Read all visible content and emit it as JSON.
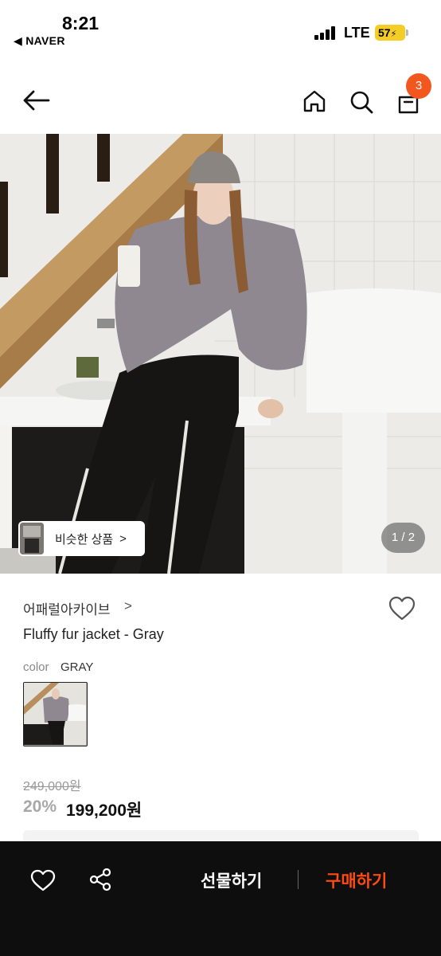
{
  "status_bar": {
    "time": "8:21",
    "back_app": "◀ NAVER",
    "network": "LTE",
    "battery": "57"
  },
  "header": {
    "cart_count": "3"
  },
  "hero": {
    "similar_label": "비슷한 상품",
    "similar_chevron": ">",
    "pager": "1 / 2"
  },
  "product": {
    "brand": "어패럴아카이브",
    "brand_chevron": ">",
    "title": "Fluffy fur jacket - Gray",
    "color_label": "color",
    "color_value": "GRAY",
    "original_price": "249,000원",
    "discount": "20%",
    "price": "199,200원"
  },
  "bottom_bar": {
    "gift_label": "선물하기",
    "buy_label": "구매하기"
  },
  "colors": {
    "accent": "#f2571f",
    "buy": "#ff4a12",
    "bar_bg": "#0e0e0e"
  }
}
